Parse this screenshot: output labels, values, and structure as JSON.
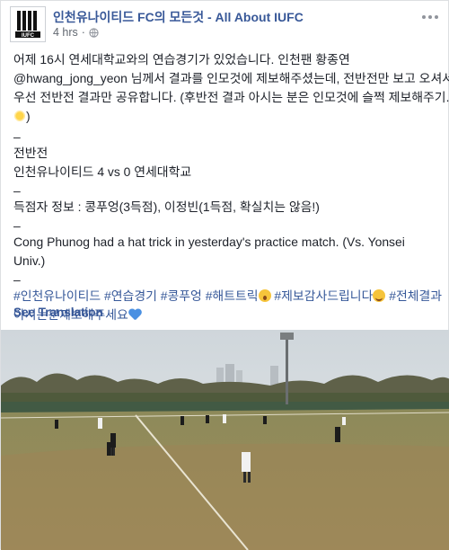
{
  "post": {
    "page_name": "인천유나이티드 FC의 모든것 - All About IUFC",
    "timestamp": "4 hrs",
    "separator_dot": "·",
    "logo_text": "IUFC",
    "body": {
      "line1": "어제 16시 연세대학교와의 연습경기가 있었습니다. 인천팬 황종연",
      "line2": "@hwang_jong_yeon 님께서 결과를 인모것에 제보해주셨는데, 전반전만 보고 오셔서",
      "line3": "우선 전반전 결과만 공유합니다. (후반전 결과 아시는 분은 인모것에 슬쩍 제보해주기...",
      "line4_end": ")",
      "dash": "–",
      "half_label": "전반전",
      "score": "인천유나이티드 4 vs 0 연세대학교",
      "scorers": "득점자 정보 : 콩푸엉(3득점), 이정빈(1득점, 확실치는 않음!)",
      "english1": "Cong Phunog had a hat trick in yesterday's practice match. (Vs. Yonsei",
      "english2": "Univ.)"
    },
    "hashtags": {
      "tag1": "#인천유나이티드",
      "tag2": "#연습경기",
      "tag3": "#콩푸엉",
      "tag4": "#해트트릭",
      "tag5": "#제보감사드립니다",
      "tag6": "#전체결과",
      "tag6_cont": "아시는분제보해주세요"
    },
    "see_translation": "See Translation"
  },
  "icons": {
    "globe": "globe-icon",
    "more": "more-options-icon",
    "sun": "sun-emoji-icon",
    "wow": "surprised-emoji-icon",
    "smile": "smiling-emoji-icon",
    "heart": "blue-heart-emoji-icon"
  },
  "colors": {
    "link": "#385898",
    "hashtag": "#365899",
    "meta": "#616770",
    "text": "#1d2129"
  }
}
